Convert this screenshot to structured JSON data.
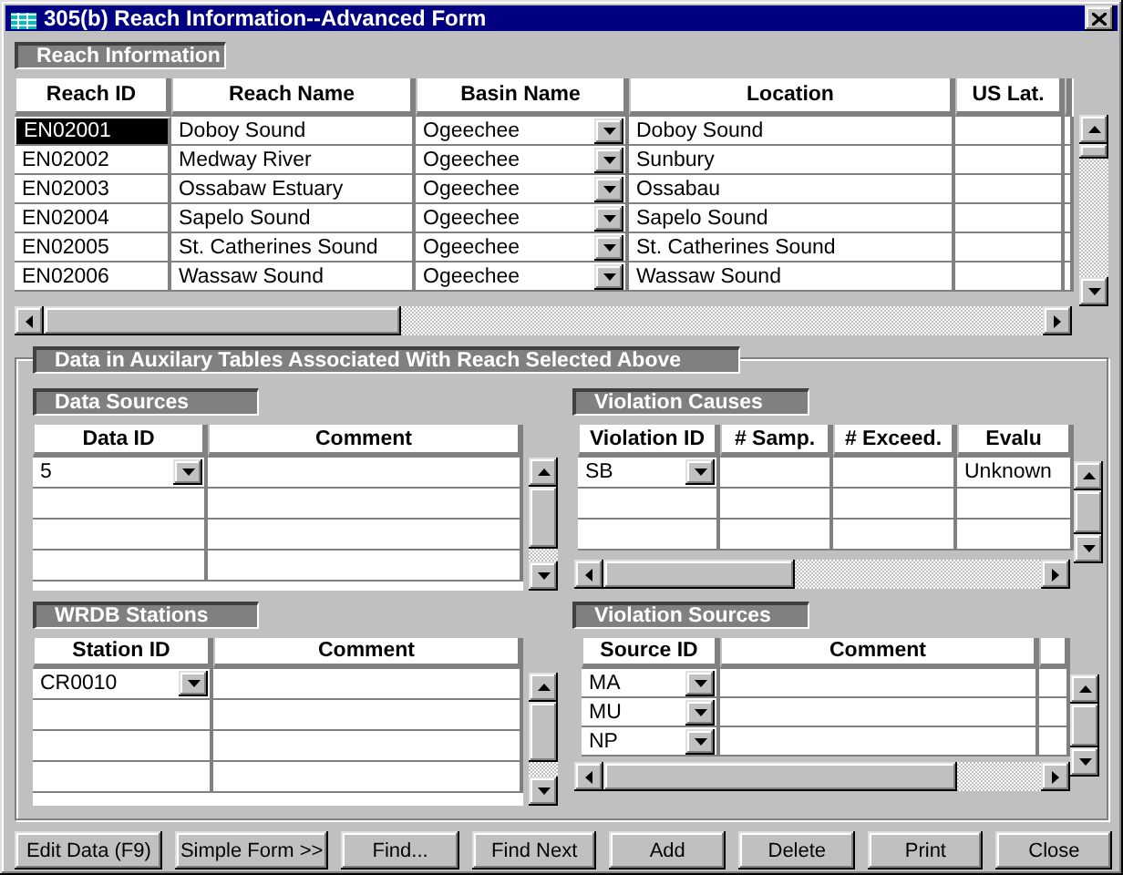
{
  "window": {
    "title": "305(b) Reach Information--Advanced Form"
  },
  "reach_information": {
    "label": "Reach Information",
    "columns": [
      {
        "label": "Reach ID",
        "kind": "text"
      },
      {
        "label": "Reach Name",
        "kind": "text"
      },
      {
        "label": "Basin Name",
        "kind": "combo"
      },
      {
        "label": "Location",
        "kind": "text"
      },
      {
        "label": "US Lat.",
        "kind": "text"
      }
    ],
    "rows": [
      {
        "selected": true,
        "cells": [
          "EN02001",
          "Doboy Sound",
          "Ogeechee",
          "Doboy Sound",
          null
        ]
      },
      {
        "selected": false,
        "cells": [
          "EN02002",
          "Medway River",
          "Ogeechee",
          "Sunbury",
          null
        ]
      },
      {
        "selected": false,
        "cells": [
          "EN02003",
          "Ossabaw Estuary",
          "Ogeechee",
          "Ossabau",
          null
        ]
      },
      {
        "selected": false,
        "cells": [
          "EN02004",
          "Sapelo Sound",
          "Ogeechee",
          "Sapelo Sound",
          null
        ]
      },
      {
        "selected": false,
        "cells": [
          "EN02005",
          "St. Catherines Sound",
          "Ogeechee",
          "St. Catherines Sound",
          null
        ]
      },
      {
        "selected": false,
        "cells": [
          "EN02006",
          "Wassaw Sound",
          "Ogeechee",
          "Wassaw Sound",
          null
        ]
      }
    ]
  },
  "auxiliary": {
    "label": "Data in Auxilary Tables Associated With Reach Selected Above",
    "data_sources": {
      "label": "Data Sources",
      "columns": [
        {
          "label": "Data ID",
          "kind": "combo"
        },
        {
          "label": "Comment",
          "kind": "text"
        }
      ],
      "rows": [
        {
          "cells": [
            "5",
            null
          ]
        }
      ]
    },
    "violation_causes": {
      "label": "Violation Causes",
      "columns": [
        {
          "label": "Violation ID",
          "kind": "combo"
        },
        {
          "label": "# Samp.",
          "kind": "text"
        },
        {
          "label": "# Exceed.",
          "kind": "text"
        },
        {
          "label": "Evalu",
          "kind": "text"
        }
      ],
      "rows": [
        {
          "cells": [
            "SB",
            null,
            null,
            "Unknown"
          ]
        }
      ]
    },
    "wrdb_stations": {
      "label": "WRDB Stations",
      "columns": [
        {
          "label": "Station ID",
          "kind": "combo"
        },
        {
          "label": "Comment",
          "kind": "text"
        }
      ],
      "rows": [
        {
          "cells": [
            "CR0010",
            null
          ]
        }
      ]
    },
    "violation_sources": {
      "label": "Violation Sources",
      "columns": [
        {
          "label": "Source ID",
          "kind": "combo"
        },
        {
          "label": "Comment",
          "kind": "text"
        }
      ],
      "rows": [
        {
          "cells": [
            "MA",
            null
          ]
        },
        {
          "cells": [
            "MU",
            null
          ]
        },
        {
          "cells": [
            "NP",
            null
          ]
        }
      ]
    }
  },
  "buttons": [
    {
      "label": "Edit Data (F9)"
    },
    {
      "label": "Simple Form >>"
    },
    {
      "label": "Find..."
    },
    {
      "label": "Find Next"
    },
    {
      "label": "Add"
    },
    {
      "label": "Delete"
    },
    {
      "label": "Print"
    },
    {
      "label": "Close"
    }
  ]
}
